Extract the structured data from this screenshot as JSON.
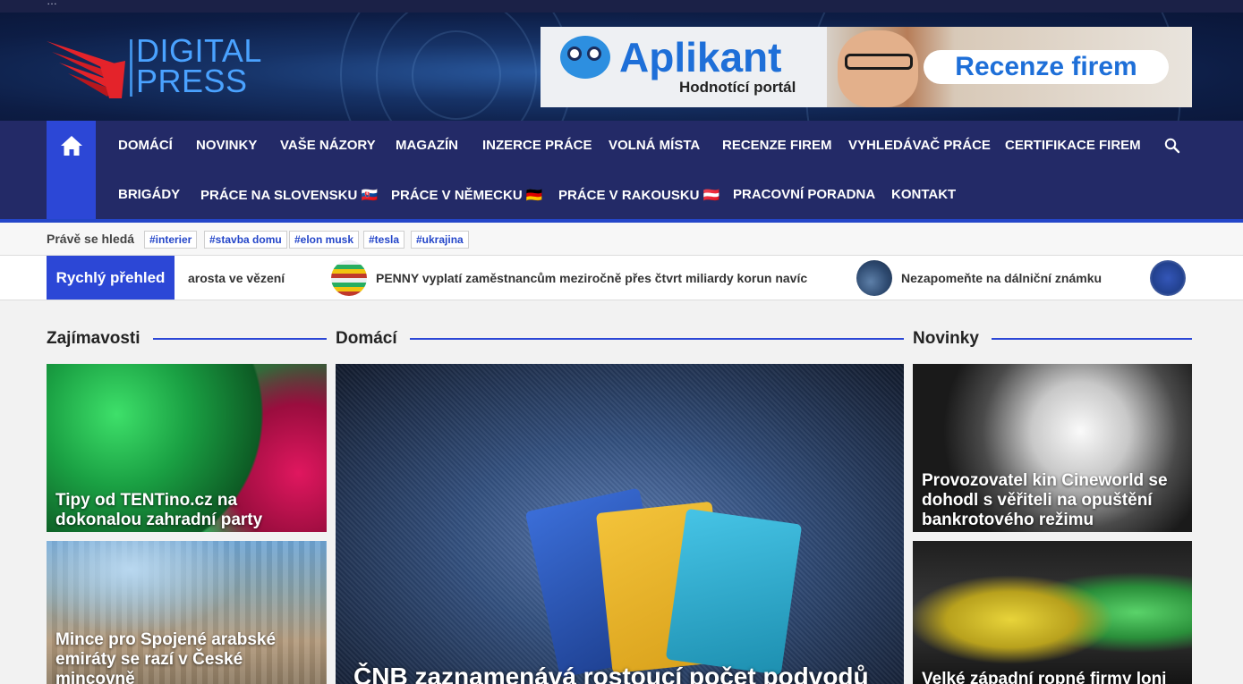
{
  "topbar": {
    "date": "…"
  },
  "logo": {
    "line1": "DIGITAL",
    "line2": "PRESS"
  },
  "banner": {
    "brand": "Aplikant",
    "subtitle": "Hodnotící portál",
    "cta": "Recenze firem"
  },
  "nav": {
    "row1": [
      "DOMÁCÍ",
      "NOVINKY",
      "VAŠE NÁZORY",
      "MAGAZÍN",
      "INZERCE PRÁCE",
      "VOLNÁ MÍSTA",
      "RECENZE FIREM",
      "VYHLEDÁVAČ PRÁCE",
      "CERTIFIKACE FIREM"
    ],
    "row2": [
      "BRIGÁDY",
      "PRÁCE NA SLOVENSKU 🇸🇰",
      "PRÁCE V NĚMECKU 🇩🇪",
      "PRÁCE V RAKOUSKU 🇦🇹",
      "PRACOVNÍ PORADNA",
      "KONTAKT"
    ]
  },
  "trending": {
    "label": "Právě se hledá",
    "tags": [
      "#interier",
      "#stavba domu",
      "#elon musk",
      "#tesla",
      "#ukrajina"
    ]
  },
  "ticker": {
    "label": "Rychlý přehled",
    "items": [
      "arosta ve vězení",
      "PENNY vyplatí zaměstnancům meziročně přes čtvrt miliardy korun navíc",
      "Nezapomeňte na dálniční známku"
    ]
  },
  "sections": {
    "left": "Zajímavosti",
    "middle": "Domácí",
    "right": "Novinky"
  },
  "articles": {
    "left": [
      "Tipy od TENTino.cz na dokonalou zahradní party",
      "Mince pro Spojené arabské emiráty se razí v České mincovně"
    ],
    "middle": "ČNB zaznamenává rostoucí počet podvodů",
    "right": [
      "Provozovatel kin Cineworld se dohodl s věřiteli na opuštění bankrotového režimu",
      "Velké západní ropné firmy loni"
    ]
  },
  "colors": {
    "accent": "#2c47d6",
    "nav": "#232a67",
    "topbar": "#1b2147"
  }
}
